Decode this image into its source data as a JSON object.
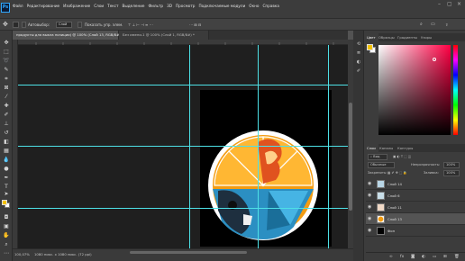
{
  "menubar": {
    "logo": "Ps",
    "items": [
      "Файл",
      "Редактирование",
      "Изображение",
      "Слои",
      "Текст",
      "Выделение",
      "Фильтр",
      "3D",
      "Просмотр",
      "Подключаемые модули",
      "Окно",
      "Справка"
    ]
  },
  "options": {
    "auto_select_label": "Автовыбор:",
    "auto_select_value": "Слой",
    "transform_label": "Показать упр. элем."
  },
  "tabs": [
    {
      "label": "продукты для выкла позиции) @ 100% (Слой 13, RGB/8#) *",
      "close": "×"
    },
    {
      "label": "Без имени-1 @ 100% (Слой 1, RGB/8#) *",
      "close": "×"
    }
  ],
  "status": {
    "zoom": "100,07%",
    "doc": "1080 пикс. x 1080 пикс. (72 ppi)"
  },
  "panels": {
    "color_tabs": [
      "Цвет",
      "Образцы",
      "Градиенты",
      "Узоры"
    ],
    "layer_tabs": [
      "Слои",
      "Каналы",
      "Контуры"
    ],
    "search_kind": "Вид",
    "blend_mode": "Обычные",
    "opacity_label": "Непрозрачность:",
    "opacity_value": "100%",
    "lock_label": "Закрепить:",
    "fill_label": "Заливка:",
    "fill_value": "100%",
    "layers": [
      {
        "name": "Слой 14"
      },
      {
        "name": "Слой 6"
      },
      {
        "name": "Слой 11"
      },
      {
        "name": "Слой 13"
      },
      {
        "name": "Фон"
      }
    ]
  },
  "colors": {
    "foreground": "#f2c200",
    "background": "#ffffff",
    "accent": "#31a8ff",
    "guide": "#4de0e6"
  },
  "icons": {
    "move": "move-icon",
    "eye": "eye-icon",
    "search": "search-icon"
  }
}
